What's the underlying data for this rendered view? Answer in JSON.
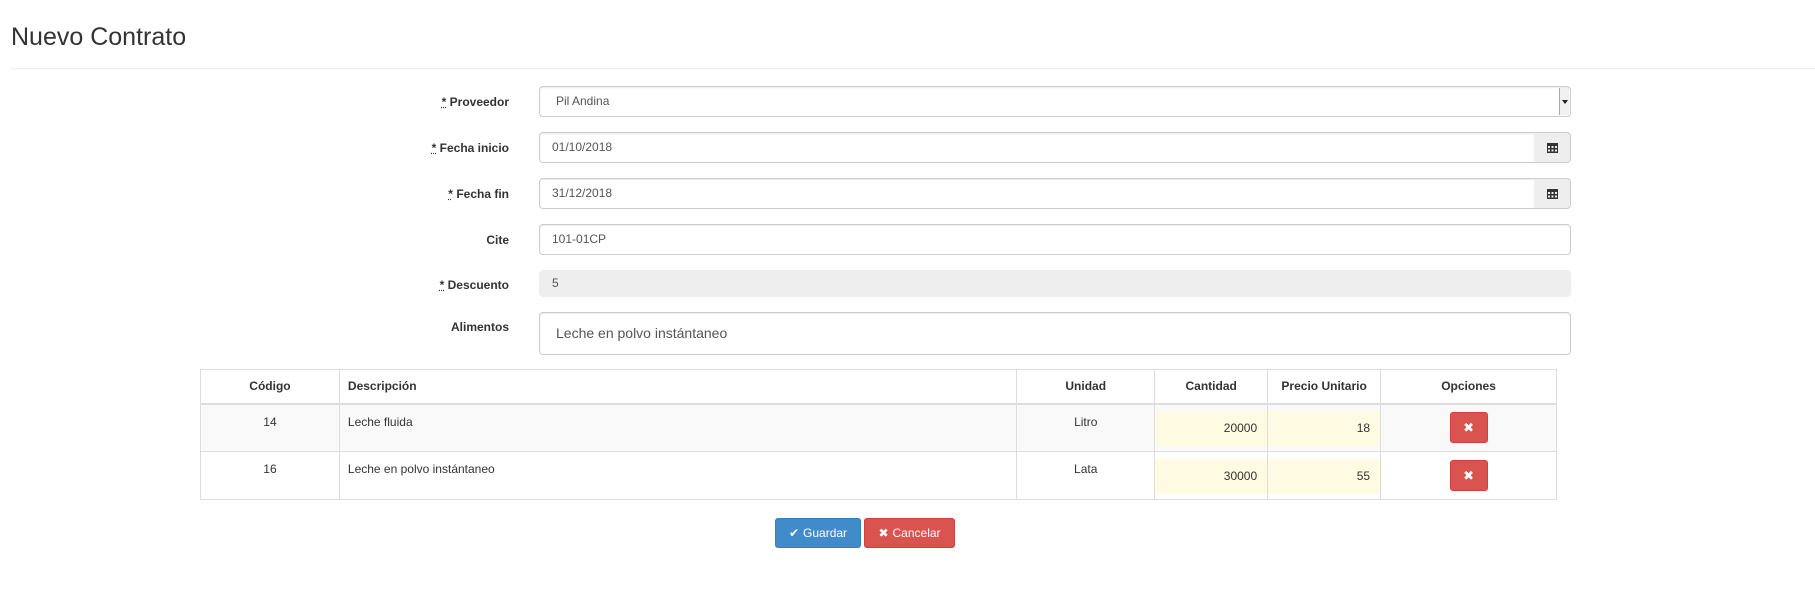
{
  "page": {
    "title": "Nuevo Contrato"
  },
  "form": {
    "required_marker": "*",
    "proveedor": {
      "label": "Proveedor",
      "value": "Pil Andina"
    },
    "fecha_inicio": {
      "label": "Fecha inicio",
      "value": "01/10/2018"
    },
    "fecha_fin": {
      "label": "Fecha fin",
      "value": "31/12/2018"
    },
    "cite": {
      "label": "Cite",
      "value": "101-01CP"
    },
    "descuento": {
      "label": "Descuento",
      "value": "5"
    },
    "alimentos": {
      "label": "Alimentos",
      "value": "Leche en polvo instántaneo"
    }
  },
  "table": {
    "headers": {
      "codigo": "Código",
      "descripcion": "Descripción",
      "unidad": "Unidad",
      "cantidad": "Cantidad",
      "precio": "Precio Unitario",
      "opciones": "Opciones"
    },
    "rows": [
      {
        "codigo": "14",
        "descripcion": "Leche fluida",
        "unidad": "Litro",
        "cantidad": "20000",
        "precio": "18"
      },
      {
        "codigo": "16",
        "descripcion": "Leche en polvo instántaneo",
        "unidad": "Lata",
        "cantidad": "30000",
        "precio": "55"
      }
    ],
    "delete_icon": "x-icon"
  },
  "actions": {
    "save": {
      "label": "Guardar",
      "icon": "check-icon",
      "color": "#428bca"
    },
    "cancel": {
      "label": "Cancelar",
      "icon": "x-icon",
      "color": "#d9534f"
    }
  }
}
